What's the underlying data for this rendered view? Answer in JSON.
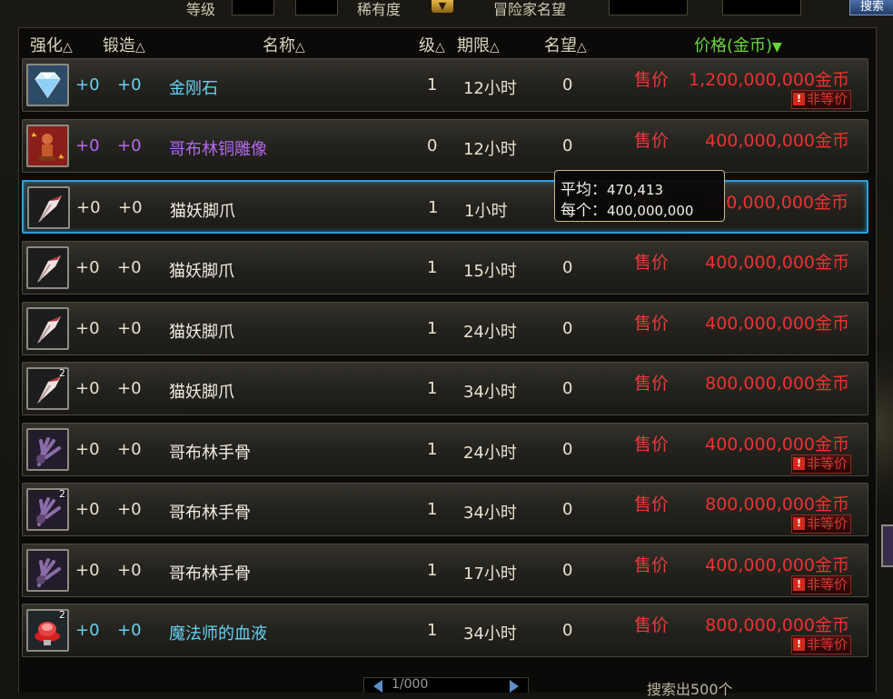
{
  "filter_bar": {
    "level_label": "等级",
    "rarity_label": "稀有度",
    "adventurer_fame_label": "冒险家名望",
    "search_button": "搜索"
  },
  "columns": {
    "enhance": "强化",
    "forge": "锻造",
    "name": "名称",
    "level": "级",
    "duration": "期限",
    "fame": "名望",
    "price": "价格(金币)",
    "sort_up": "△",
    "sort_down": "▼"
  },
  "sell_label": "售价",
  "unfair_badge": "非等价",
  "colors": {
    "accent_selected": "#2e9fd6",
    "price_red": "#ec3131",
    "header_price_green": "#6cd43c",
    "rarity_magic": "#6ad0f2",
    "rarity_rare": "#b56af0"
  },
  "rows": [
    {
      "icon": "diamond-icon",
      "stack": "",
      "enhance": "+0",
      "forge": "+0",
      "name": "金刚石",
      "rarity": "magic",
      "level": "1",
      "duration": "12小时",
      "fame": "0",
      "price": "1,200,000,000金币",
      "unfair": true
    },
    {
      "icon": "goblin-statue-icon",
      "stack": "",
      "enhance": "+0",
      "forge": "+0",
      "name": "哥布林铜雕像",
      "rarity": "rare",
      "level": "0",
      "duration": "12小时",
      "fame": "0",
      "price": "400,000,000金币",
      "unfair": false
    },
    {
      "icon": "cat-claw-icon",
      "stack": "",
      "enhance": "+0",
      "forge": "+0",
      "name": "猫妖脚爪",
      "rarity": "common",
      "level": "1",
      "duration": "1小时",
      "fame": "",
      "price": "400,000,000金币",
      "unfair": false
    },
    {
      "icon": "cat-claw-icon",
      "stack": "",
      "enhance": "+0",
      "forge": "+0",
      "name": "猫妖脚爪",
      "rarity": "common",
      "level": "1",
      "duration": "15小时",
      "fame": "0",
      "price": "400,000,000金币",
      "unfair": false
    },
    {
      "icon": "cat-claw-icon",
      "stack": "",
      "enhance": "+0",
      "forge": "+0",
      "name": "猫妖脚爪",
      "rarity": "common",
      "level": "1",
      "duration": "24小时",
      "fame": "0",
      "price": "400,000,000金币",
      "unfair": false
    },
    {
      "icon": "cat-claw-icon",
      "stack": "2",
      "enhance": "+0",
      "forge": "+0",
      "name": "猫妖脚爪",
      "rarity": "common",
      "level": "1",
      "duration": "34小时",
      "fame": "0",
      "price": "800,000,000金币",
      "unfair": false
    },
    {
      "icon": "goblin-hand-bone-icon",
      "stack": "",
      "enhance": "+0",
      "forge": "+0",
      "name": "哥布林手骨",
      "rarity": "common",
      "level": "1",
      "duration": "24小时",
      "fame": "0",
      "price": "400,000,000金币",
      "unfair": true
    },
    {
      "icon": "goblin-hand-bone-icon",
      "stack": "2",
      "enhance": "+0",
      "forge": "+0",
      "name": "哥布林手骨",
      "rarity": "common",
      "level": "1",
      "duration": "34小时",
      "fame": "0",
      "price": "800,000,000金币",
      "unfair": true
    },
    {
      "icon": "goblin-hand-bone-icon",
      "stack": "",
      "enhance": "+0",
      "forge": "+0",
      "name": "哥布林手骨",
      "rarity": "common",
      "level": "1",
      "duration": "17小时",
      "fame": "0",
      "price": "400,000,000金币",
      "unfair": true
    },
    {
      "icon": "mage-blood-icon",
      "stack": "2",
      "enhance": "+0",
      "forge": "+0",
      "name": "魔法师的血液",
      "rarity": "magic",
      "level": "1",
      "duration": "34小时",
      "fame": "0",
      "price": "800,000,000金币",
      "unfair": true
    }
  ],
  "selected_row": 2,
  "tooltip": {
    "average_label": "平均",
    "average_value": "470,413",
    "each_label": "每个",
    "each_value": "400,000,000",
    "separator": "："
  },
  "pager": {
    "page_text": "1/000"
  },
  "bottom_status": "搜索出500个"
}
